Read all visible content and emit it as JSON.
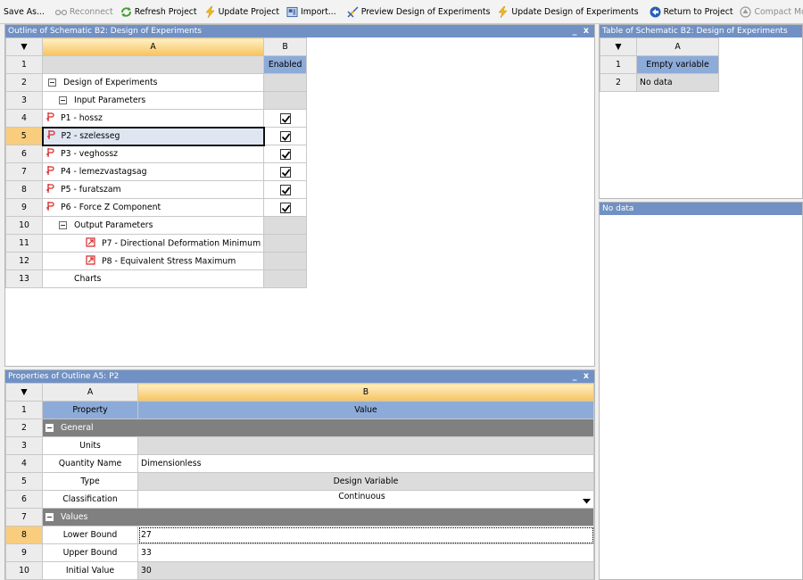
{
  "toolbar": {
    "save_as": "Save As...",
    "reconnect": "Reconnect",
    "refresh_project": "Refresh Project",
    "update_project": "Update Project",
    "import": "Import...",
    "preview_doe": "Preview Design of Experiments",
    "update_doe": "Update Design of Experiments",
    "return_to_project": "Return to Project",
    "compact_mode": "Compact Mode"
  },
  "outline": {
    "title": "Outline of Schematic B2: Design of Experiments",
    "close": "x",
    "minimize": "_",
    "sort_glyph": "▼",
    "col_a": "A",
    "col_b": "B",
    "rows": [
      {
        "n": "1",
        "a": "",
        "b": "Enabled"
      },
      {
        "n": "2",
        "a": "Design of Experiments",
        "b": ""
      },
      {
        "n": "3",
        "a": "Input Parameters",
        "b": ""
      },
      {
        "n": "4",
        "a": "P1 - hossz",
        "b": ""
      },
      {
        "n": "5",
        "a": "P2 - szelesseg",
        "b": ""
      },
      {
        "n": "6",
        "a": "P3 - veghossz",
        "b": ""
      },
      {
        "n": "7",
        "a": "P4 - lemezvastagsag",
        "b": ""
      },
      {
        "n": "8",
        "a": "P5 - furatszam",
        "b": ""
      },
      {
        "n": "9",
        "a": "P6 - Force Z Component",
        "b": ""
      },
      {
        "n": "10",
        "a": "Output Parameters",
        "b": ""
      },
      {
        "n": "11",
        "a": "P7 - Directional Deformation Minimum",
        "b": ""
      },
      {
        "n": "12",
        "a": "P8 - Equivalent Stress Maximum",
        "b": ""
      },
      {
        "n": "13",
        "a": "Charts",
        "b": ""
      }
    ]
  },
  "table": {
    "title": "Table of Schematic B2: Design of Experiments",
    "sort_glyph": "▼",
    "col_a": "A",
    "rows": [
      {
        "n": "1",
        "a": "Empty variable"
      },
      {
        "n": "2",
        "a": "No data"
      }
    ]
  },
  "chart": {
    "title": "No data"
  },
  "properties": {
    "title": "Properties of Outline A5: P2",
    "close": "x",
    "minimize": "_",
    "sort_glyph": "▼",
    "col_a": "A",
    "col_b": "B",
    "rows": [
      {
        "n": "1",
        "a": "Property",
        "b": "Value"
      },
      {
        "n": "2",
        "a": "General",
        "b": ""
      },
      {
        "n": "3",
        "a": "Units",
        "b": ""
      },
      {
        "n": "4",
        "a": "Quantity Name",
        "b": "Dimensionless"
      },
      {
        "n": "5",
        "a": "Type",
        "b": "Design Variable"
      },
      {
        "n": "6",
        "a": "Classification",
        "b": "Continuous"
      },
      {
        "n": "7",
        "a": "Values",
        "b": ""
      },
      {
        "n": "8",
        "a": "Lower Bound",
        "b": "27"
      },
      {
        "n": "9",
        "a": "Upper Bound",
        "b": "33"
      },
      {
        "n": "10",
        "a": "Initial Value",
        "b": "30"
      }
    ]
  },
  "colors": {
    "title_bar": "#7191c4",
    "selected_header": "#f6c35f",
    "enabled_header": "#8dabd8",
    "param_icon": "#d62a2a"
  }
}
